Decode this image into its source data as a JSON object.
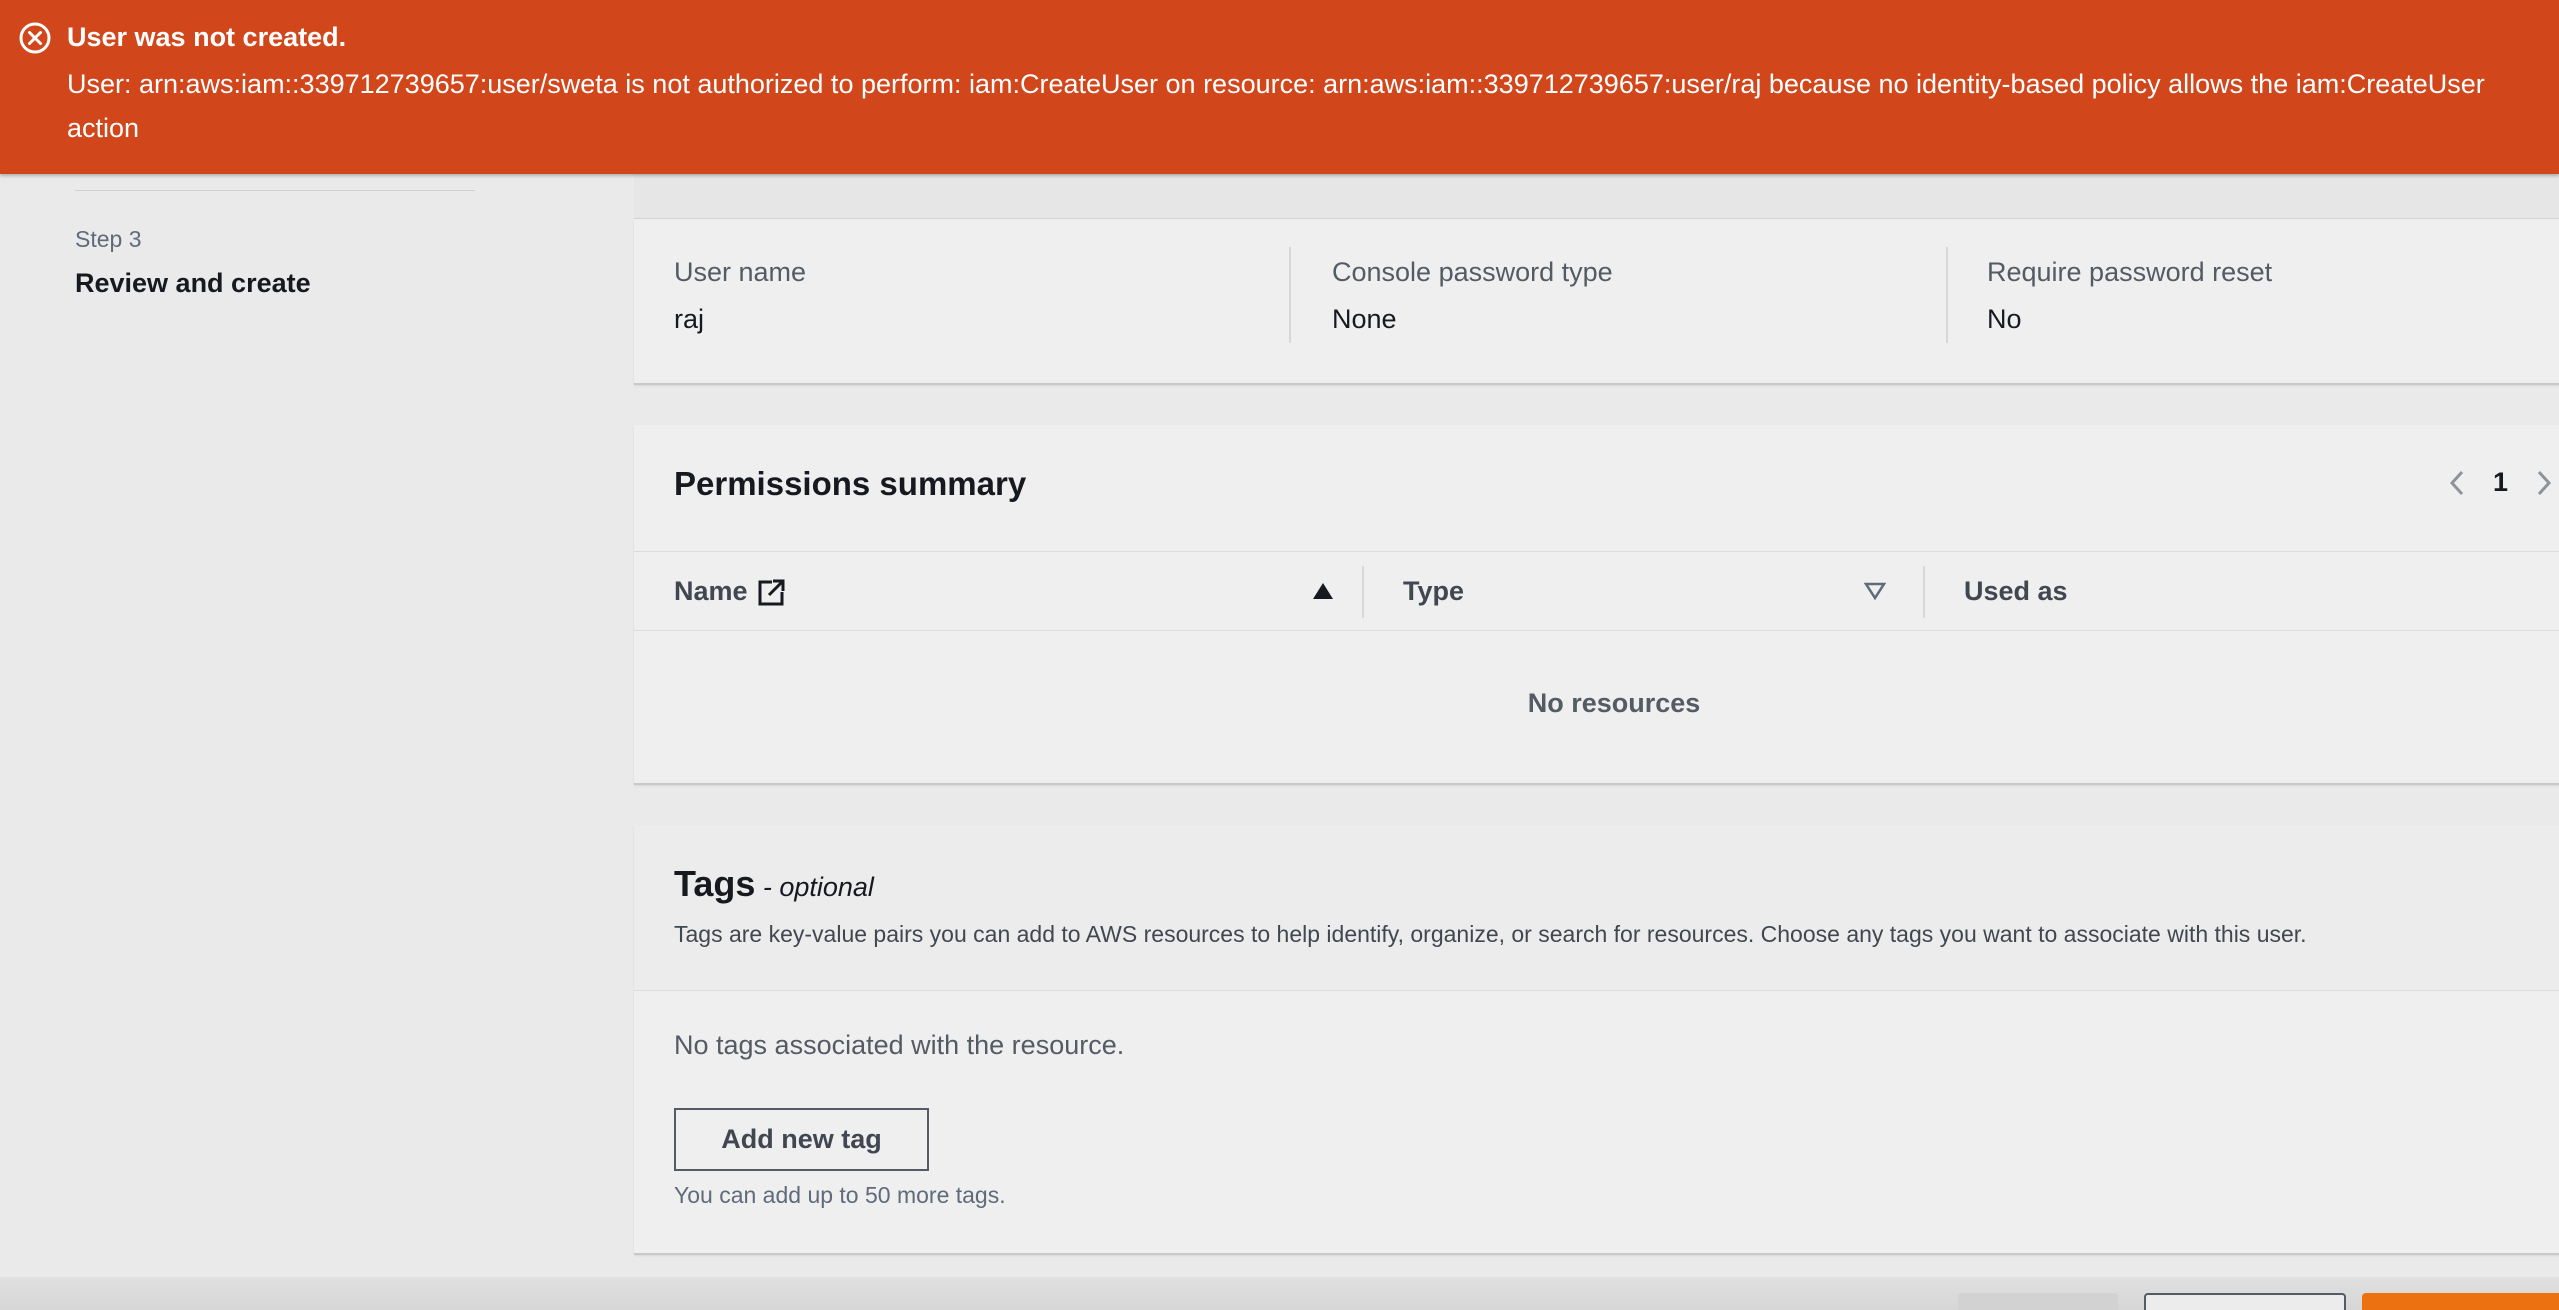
{
  "flash": {
    "title": "User was not created.",
    "message": "User: arn:aws:iam::339712739657:user/sweta is not authorized to perform: iam:CreateUser on resource: arn:aws:iam::339712739657:user/raj because no identity-based policy allows the iam:CreateUser action",
    "icon": "error-circle-icon",
    "color": "#d1461a"
  },
  "nav": {
    "step_label": "Step 3",
    "step_title": "Review and create"
  },
  "user_details": {
    "fields": [
      {
        "label": "User name",
        "value": "raj"
      },
      {
        "label": "Console password type",
        "value": "None"
      },
      {
        "label": "Require password reset",
        "value": "No"
      }
    ]
  },
  "permissions": {
    "title": "Permissions summary",
    "page": "1",
    "columns": [
      "Name",
      "Type",
      "Used as"
    ],
    "empty": "No resources"
  },
  "tags": {
    "title": "Tags",
    "optional": " - optional",
    "description": "Tags are key-value pairs you can add to AWS resources to help identify, organize, or search for resources. Choose any tags you want to associate with this user.",
    "empty": "No tags associated with the resource.",
    "add_button": "Add new tag",
    "limit": "You can add up to 50 more tags."
  },
  "colors": {
    "primary_button": "#ec7211",
    "background": "#eaeaea"
  }
}
